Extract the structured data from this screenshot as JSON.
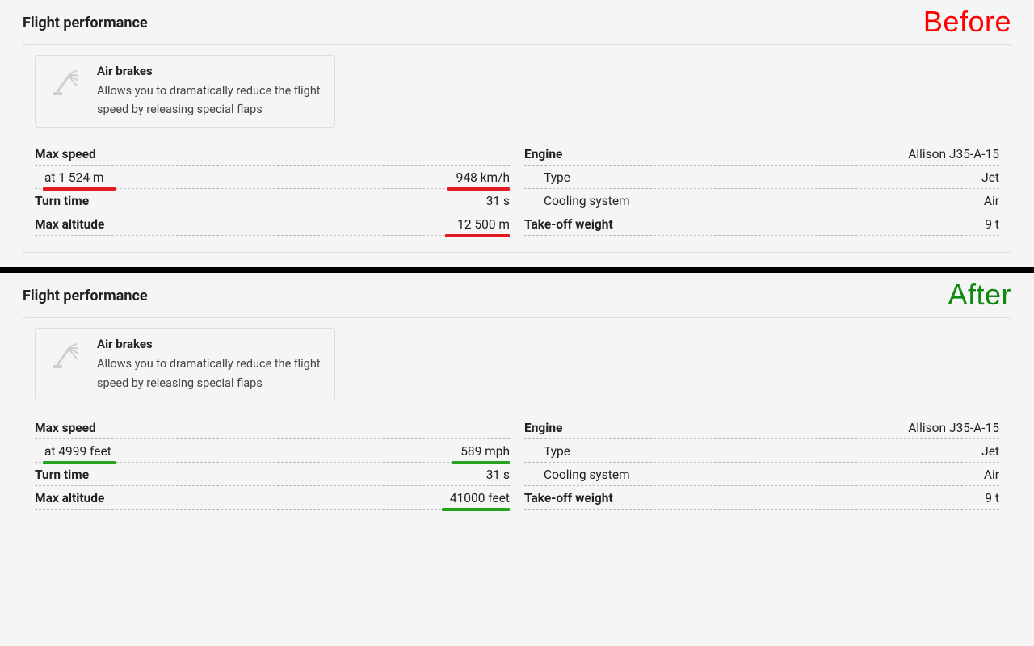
{
  "labels": {
    "before": "Before",
    "after": "After",
    "section_title": "Flight performance",
    "feature_title": "Air brakes",
    "feature_desc": "Allows you to dramatically reduce the flight speed by releasing special flaps",
    "max_speed": "Max speed",
    "turn_time": "Turn time",
    "max_altitude": "Max altitude",
    "engine": "Engine",
    "type": "Type",
    "cooling": "Cooling system",
    "takeoff": "Take-off weight"
  },
  "before": {
    "max_speed_at": "at 1 524 m",
    "max_speed_val": "948 km/h",
    "turn_time_val": "31 s",
    "max_altitude_val": "12 500 m",
    "engine_val": "Allison J35-A-15",
    "type_val": "Jet",
    "cooling_val": "Air",
    "takeoff_val": "9 t"
  },
  "after": {
    "max_speed_at": "at 4999 feet",
    "max_speed_val": "589 mph",
    "turn_time_val": "31 s",
    "max_altitude_val": "41000 feet",
    "engine_val": "Allison J35-A-15",
    "type_val": "Jet",
    "cooling_val": "Air",
    "takeoff_val": "9 t"
  }
}
